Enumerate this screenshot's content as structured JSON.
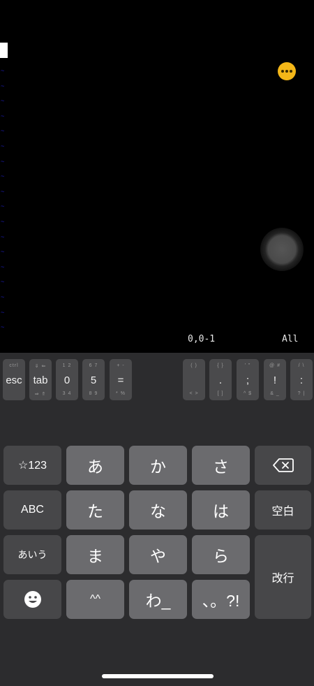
{
  "terminal": {
    "tilde_count": 18,
    "status_position": "0,0-1",
    "status_view": "All",
    "menu_button_icon": "ellipsis-icon",
    "trackpad_icon": "trackpad-icon"
  },
  "extra_keys": [
    {
      "name": "esc",
      "top": "ctrl",
      "main": "esc",
      "bottom": ""
    },
    {
      "name": "tab",
      "top": "⇓ ⇐",
      "main": "tab",
      "bottom": "⇒ ⇑"
    },
    {
      "name": "0",
      "top": "1  2",
      "main": "0",
      "bottom": "3  4"
    },
    {
      "name": "5",
      "top": "6  7",
      "main": "5",
      "bottom": "8  9"
    },
    {
      "name": "equals",
      "top": "+  -",
      "main": "=",
      "bottom": "*  %"
    },
    {
      "name": "paren",
      "top": "(  )",
      "main": "",
      "bottom": "<  >"
    },
    {
      "name": "brace",
      "top": "{  }",
      "main": ".",
      "bottom": "[  ]"
    },
    {
      "name": "semicolon",
      "top": "'  \"",
      "main": ";",
      "bottom": "^  $"
    },
    {
      "name": "exclaim",
      "top": "@  #",
      "main": "!",
      "bottom": "&  _"
    },
    {
      "name": "colon",
      "top": "/  \\",
      "main": ":",
      "bottom": "?  |"
    }
  ],
  "keyboard": {
    "keys": [
      {
        "name": "symbols-key",
        "label": "☆123",
        "style": "dark",
        "size": "sm"
      },
      {
        "name": "kana-a-key",
        "label": "あ",
        "style": "light",
        "size": ""
      },
      {
        "name": "kana-ka-key",
        "label": "か",
        "style": "light",
        "size": ""
      },
      {
        "name": "kana-sa-key",
        "label": "さ",
        "style": "light",
        "size": ""
      },
      {
        "name": "backspace-key",
        "label": "",
        "style": "dark",
        "size": ""
      },
      {
        "name": "abc-key",
        "label": "ABC",
        "style": "dark",
        "size": "sm"
      },
      {
        "name": "kana-ta-key",
        "label": "た",
        "style": "light",
        "size": ""
      },
      {
        "name": "kana-na-key",
        "label": "な",
        "style": "light",
        "size": ""
      },
      {
        "name": "kana-ha-key",
        "label": "は",
        "style": "light",
        "size": ""
      },
      {
        "name": "space-key",
        "label": "空白",
        "style": "dark",
        "size": "sm"
      },
      {
        "name": "hiragana-mode-key",
        "label": "あいう",
        "style": "dark",
        "size": "xs"
      },
      {
        "name": "kana-ma-key",
        "label": "ま",
        "style": "light",
        "size": ""
      },
      {
        "name": "kana-ya-key",
        "label": "や",
        "style": "light",
        "size": ""
      },
      {
        "name": "kana-ra-key",
        "label": "ら",
        "style": "light",
        "size": ""
      },
      {
        "name": "return-key",
        "label": "改行",
        "style": "dark",
        "size": "sm"
      },
      {
        "name": "emoji-key",
        "label": "",
        "style": "dark",
        "size": ""
      },
      {
        "name": "kaomoji-key",
        "label": "^^",
        "style": "light",
        "size": "sm"
      },
      {
        "name": "kana-wa-key",
        "label": "わ_",
        "style": "light",
        "size": ""
      },
      {
        "name": "punctuation-key",
        "label": "、。?!",
        "style": "light",
        "size": ""
      }
    ]
  }
}
